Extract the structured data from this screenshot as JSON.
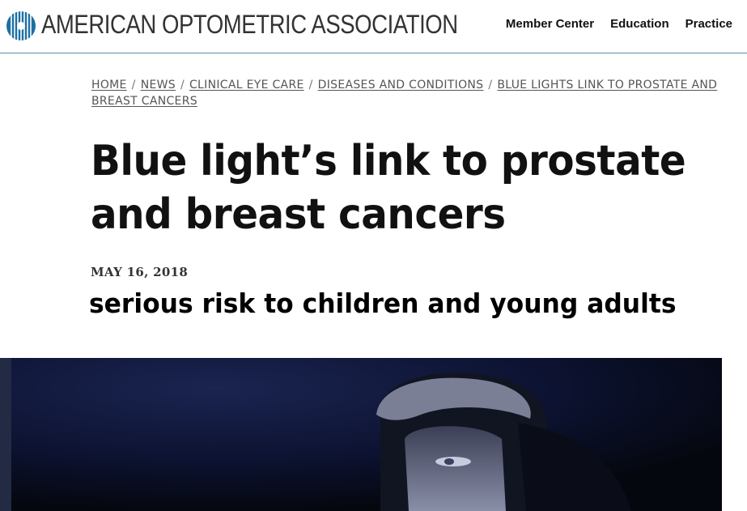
{
  "header": {
    "brand": "AMERICAN OPTOMETRIC ASSOCIATION",
    "nav": [
      {
        "label": "Member Center"
      },
      {
        "label": "Education"
      },
      {
        "label": "Practice"
      }
    ]
  },
  "breadcrumb": [
    {
      "label": "HOME"
    },
    {
      "label": "NEWS"
    },
    {
      "label": "CLINICAL EYE CARE"
    },
    {
      "label": "DISEASES AND CONDITIONS"
    },
    {
      "label": "BLUE LIGHTS LINK TO PROSTATE AND BREAST CANCERS"
    }
  ],
  "article": {
    "title": "Blue light’s link to prostate and breast cancers",
    "date": "MAY 16, 2018",
    "overlay_caption": "serious risk to children and young adults"
  },
  "colors": {
    "header_rule": "#5a8fa0",
    "logo_blue": "#1c6fa3",
    "hero_background": "#0b1024"
  },
  "icons": {
    "logo": "aoa-globe-logo"
  }
}
